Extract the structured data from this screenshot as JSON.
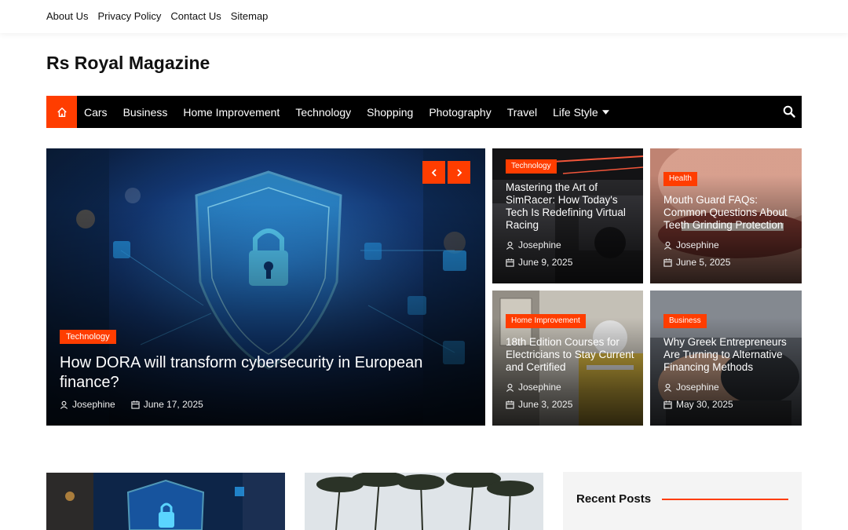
{
  "top_links": [
    "About Us",
    "Privacy Policy",
    "Contact Us",
    "Sitemap"
  ],
  "site_title": "Rs Royal Magazine",
  "nav": {
    "items": [
      "Cars",
      "Business",
      "Home Improvement",
      "Technology",
      "Shopping",
      "Photography",
      "Travel",
      "Life Style"
    ],
    "icons": [
      "home-icon",
      "search-icon",
      "caret-down-icon"
    ]
  },
  "colors": {
    "accent": "#ff3d00",
    "nav_bg": "#000000"
  },
  "featured": {
    "category": "Technology",
    "title": "How DORA will transform cybersecurity in European finance?",
    "author": "Josephine",
    "date": "June 17, 2025"
  },
  "grid_posts": [
    {
      "category": "Technology",
      "title": "Mastering the Art of SimRacer: How Today's Tech Is Redefining Virtual Racing",
      "author": "Josephine",
      "date": "June 9, 2025"
    },
    {
      "category": "Health",
      "title": "Mouth Guard FAQs: Common Questions About Teeth Grinding Protection",
      "author": "Josephine",
      "date": "June 5, 2025"
    },
    {
      "category": "Home Improvement",
      "title": "18th Edition Courses for Electricians to Stay Current and Certified",
      "author": "Josephine",
      "date": "June 3, 2025"
    },
    {
      "category": "Business",
      "title": "Why Greek Entrepreneurs Are Turning to Alternative Financing Methods",
      "author": "Josephine",
      "date": "May 30, 2025"
    }
  ],
  "sidebar": {
    "recent_heading": "Recent Posts"
  }
}
